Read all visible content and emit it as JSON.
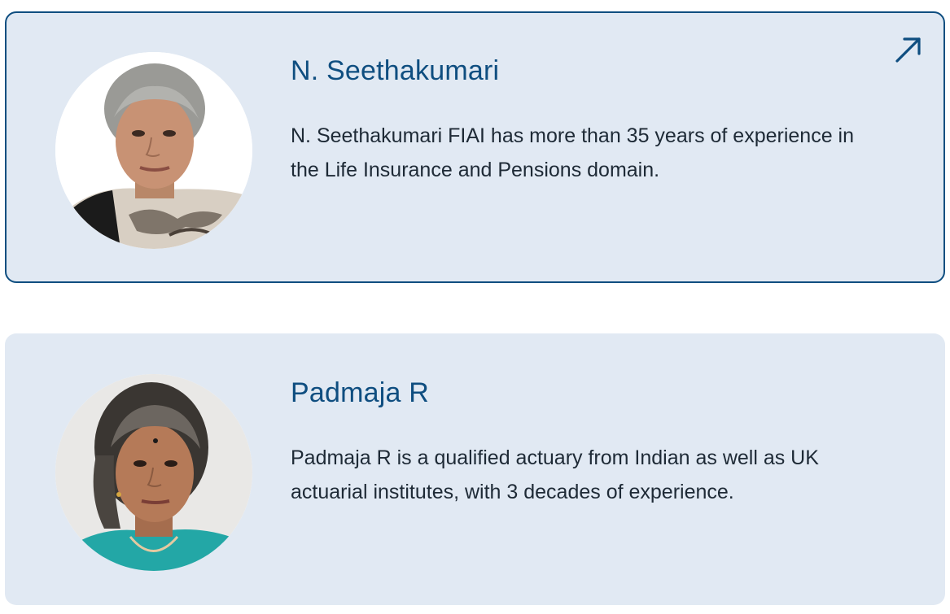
{
  "colors": {
    "card_background": "#e1e9f3",
    "name_color": "#0f4e80",
    "text_color": "#1e2a36",
    "active_border": "#0f4e80"
  },
  "people": [
    {
      "name": "N. Seethakumari",
      "bio": "N. Seethakumari FIAI has more than 35 years of experience in the Life Insurance and Pensions domain.",
      "icon": "arrow-up-right-icon"
    },
    {
      "name": "Padmaja R",
      "bio": "Padmaja R is a qualified actuary from Indian as well as UK actuarial institutes, with 3 decades of experience."
    }
  ]
}
